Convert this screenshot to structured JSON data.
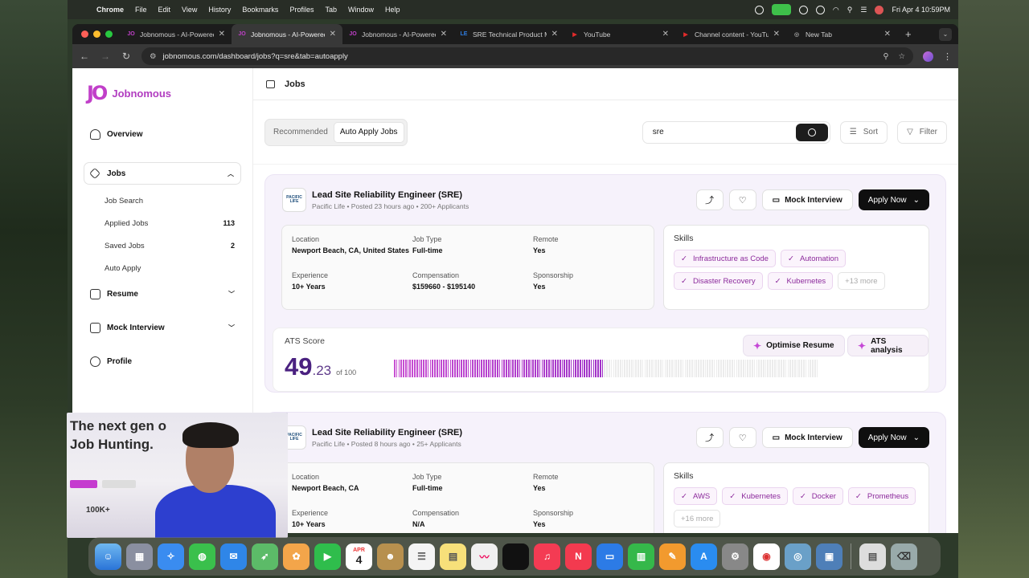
{
  "menubar": {
    "app": "Chrome",
    "items": [
      "File",
      "Edit",
      "View",
      "History",
      "Bookmarks",
      "Profiles",
      "Tab",
      "Window",
      "Help"
    ],
    "clock": "Fri Apr 4  10:59PM"
  },
  "tabs": [
    {
      "title": "Jobnomous - AI-Powered",
      "favicon": "JO",
      "color": "#c13fc9"
    },
    {
      "title": "Jobnomous - AI-Powered",
      "favicon": "JO",
      "color": "#c13fc9"
    },
    {
      "title": "Jobnomous - AI-Powered",
      "favicon": "JO",
      "color": "#c13fc9"
    },
    {
      "title": "SRE Technical Product Ma",
      "favicon": "LE",
      "color": "#2f7de1"
    },
    {
      "title": "YouTube",
      "favicon": "▶",
      "color": "#e22b2b"
    },
    {
      "title": "Channel content - YouTu",
      "favicon": "▶",
      "color": "#e22b2b"
    },
    {
      "title": "New Tab",
      "favicon": "◎",
      "color": "#8a8a8a"
    }
  ],
  "url": "jobnomous.com/dashboard/jobs?q=sre&tab=autoapply",
  "brand": {
    "name": "Jobnomous",
    "mark": "JO",
    "accent": "#c13fc9"
  },
  "sidebar": {
    "overview": "Overview",
    "jobs": "Jobs",
    "sub": [
      {
        "label": "Job Search",
        "count": ""
      },
      {
        "label": "Applied Jobs",
        "count": "113"
      },
      {
        "label": "Saved Jobs",
        "count": "2"
      },
      {
        "label": "Auto Apply",
        "count": ""
      }
    ],
    "resume": "Resume",
    "mock": "Mock Interview",
    "profile": "Profile"
  },
  "header": {
    "title": "Jobs"
  },
  "controls": {
    "tab_recommended": "Recommended",
    "tab_auto": "Auto Apply Jobs",
    "search_value": "sre",
    "sort": "Sort",
    "filter": "Filter"
  },
  "jobs": [
    {
      "company_logo": "PACIFIC LIFE",
      "title": "Lead Site Reliability Engineer (SRE)",
      "meta": "Pacific Life • Posted 23 hours ago • 200+ Applicants",
      "mock": "Mock Interview",
      "apply": "Apply Now",
      "location_label": "Location",
      "location": "Newport Beach, CA, United States",
      "type_label": "Job Type",
      "type": "Full-time",
      "remote_label": "Remote",
      "remote": "Yes",
      "exp_label": "Experience",
      "exp": "10+ Years",
      "comp_label": "Compensation",
      "comp": "$159660 - $195140",
      "sponsor_label": "Sponsorship",
      "sponsor": "Yes",
      "skills_label": "Skills",
      "skills": [
        "Infrastructure as Code",
        "Automation",
        "Disaster Recovery",
        "Kubernetes"
      ],
      "more": "+13 more",
      "ats_label": "ATS Score",
      "ats_int": "49",
      "ats_dec": ".23",
      "ats_of": "of 100",
      "ats_score": 49.23,
      "optimise": "Optimise Resume",
      "analysis": "ATS analysis"
    },
    {
      "company_logo": "PACIFIC LIFE",
      "title": "Lead Site Reliability Engineer (SRE)",
      "meta": "Pacific Life • Posted 8 hours ago • 25+ Applicants",
      "mock": "Mock Interview",
      "apply": "Apply Now",
      "location_label": "Location",
      "location": "Newport Beach, CA",
      "type_label": "Job Type",
      "type": "Full-time",
      "remote_label": "Remote",
      "remote": "Yes",
      "exp_label": "Experience",
      "exp": "10+ Years",
      "comp_label": "Compensation",
      "comp": "N/A",
      "sponsor_label": "Sponsorship",
      "sponsor": "Yes",
      "skills_label": "Skills",
      "skills": [
        "AWS",
        "Kubernetes",
        "Docker",
        "Prometheus"
      ],
      "more": "+16 more"
    }
  ],
  "webcam": {
    "headline": "The next gen o\nJob Hunting.",
    "stat": "100K+"
  },
  "dock": {
    "calendar_month": "APR",
    "calendar_day": "4"
  }
}
